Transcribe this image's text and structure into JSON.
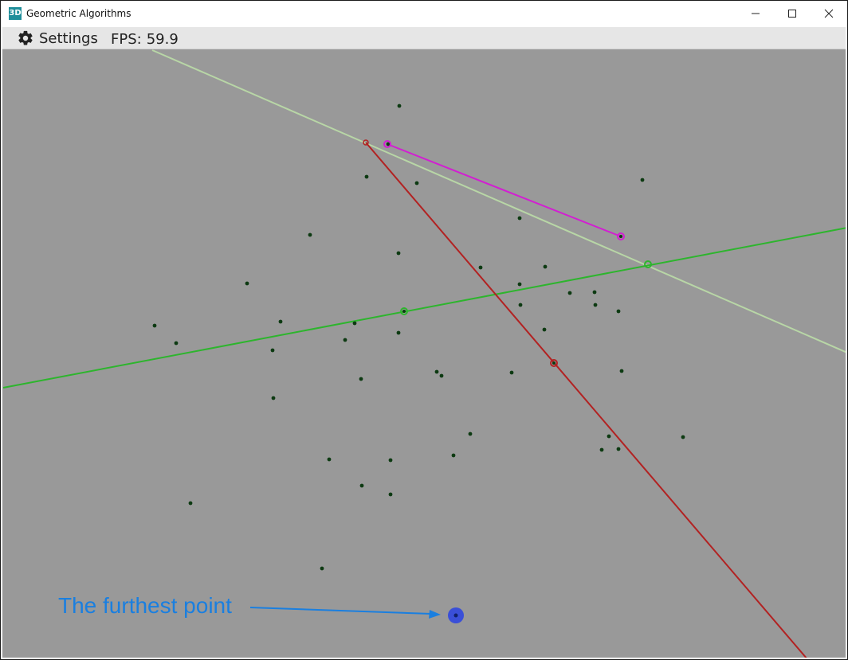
{
  "window": {
    "title": "Geometric Algorithms",
    "icon_text": "3D",
    "icon": "app-3d-icon",
    "controls": [
      "minimize-icon",
      "maximize-icon",
      "close-icon"
    ]
  },
  "menubar": {
    "settings_label": "Settings",
    "settings_icon": "gear-icon",
    "fps_label": "FPS:",
    "fps_value": "59.9"
  },
  "viewport": {
    "background": "#999999",
    "point_color": "#0d3a12",
    "annotation": {
      "text": "The furthest point",
      "color": "#1a7fe0"
    },
    "colors": {
      "red_line": "#b22222",
      "green_line": "#2db52d",
      "light_line": "#b8d6a6",
      "magenta_segment": "#d21fd2",
      "furthest_point": "#3a4fd8"
    }
  }
}
